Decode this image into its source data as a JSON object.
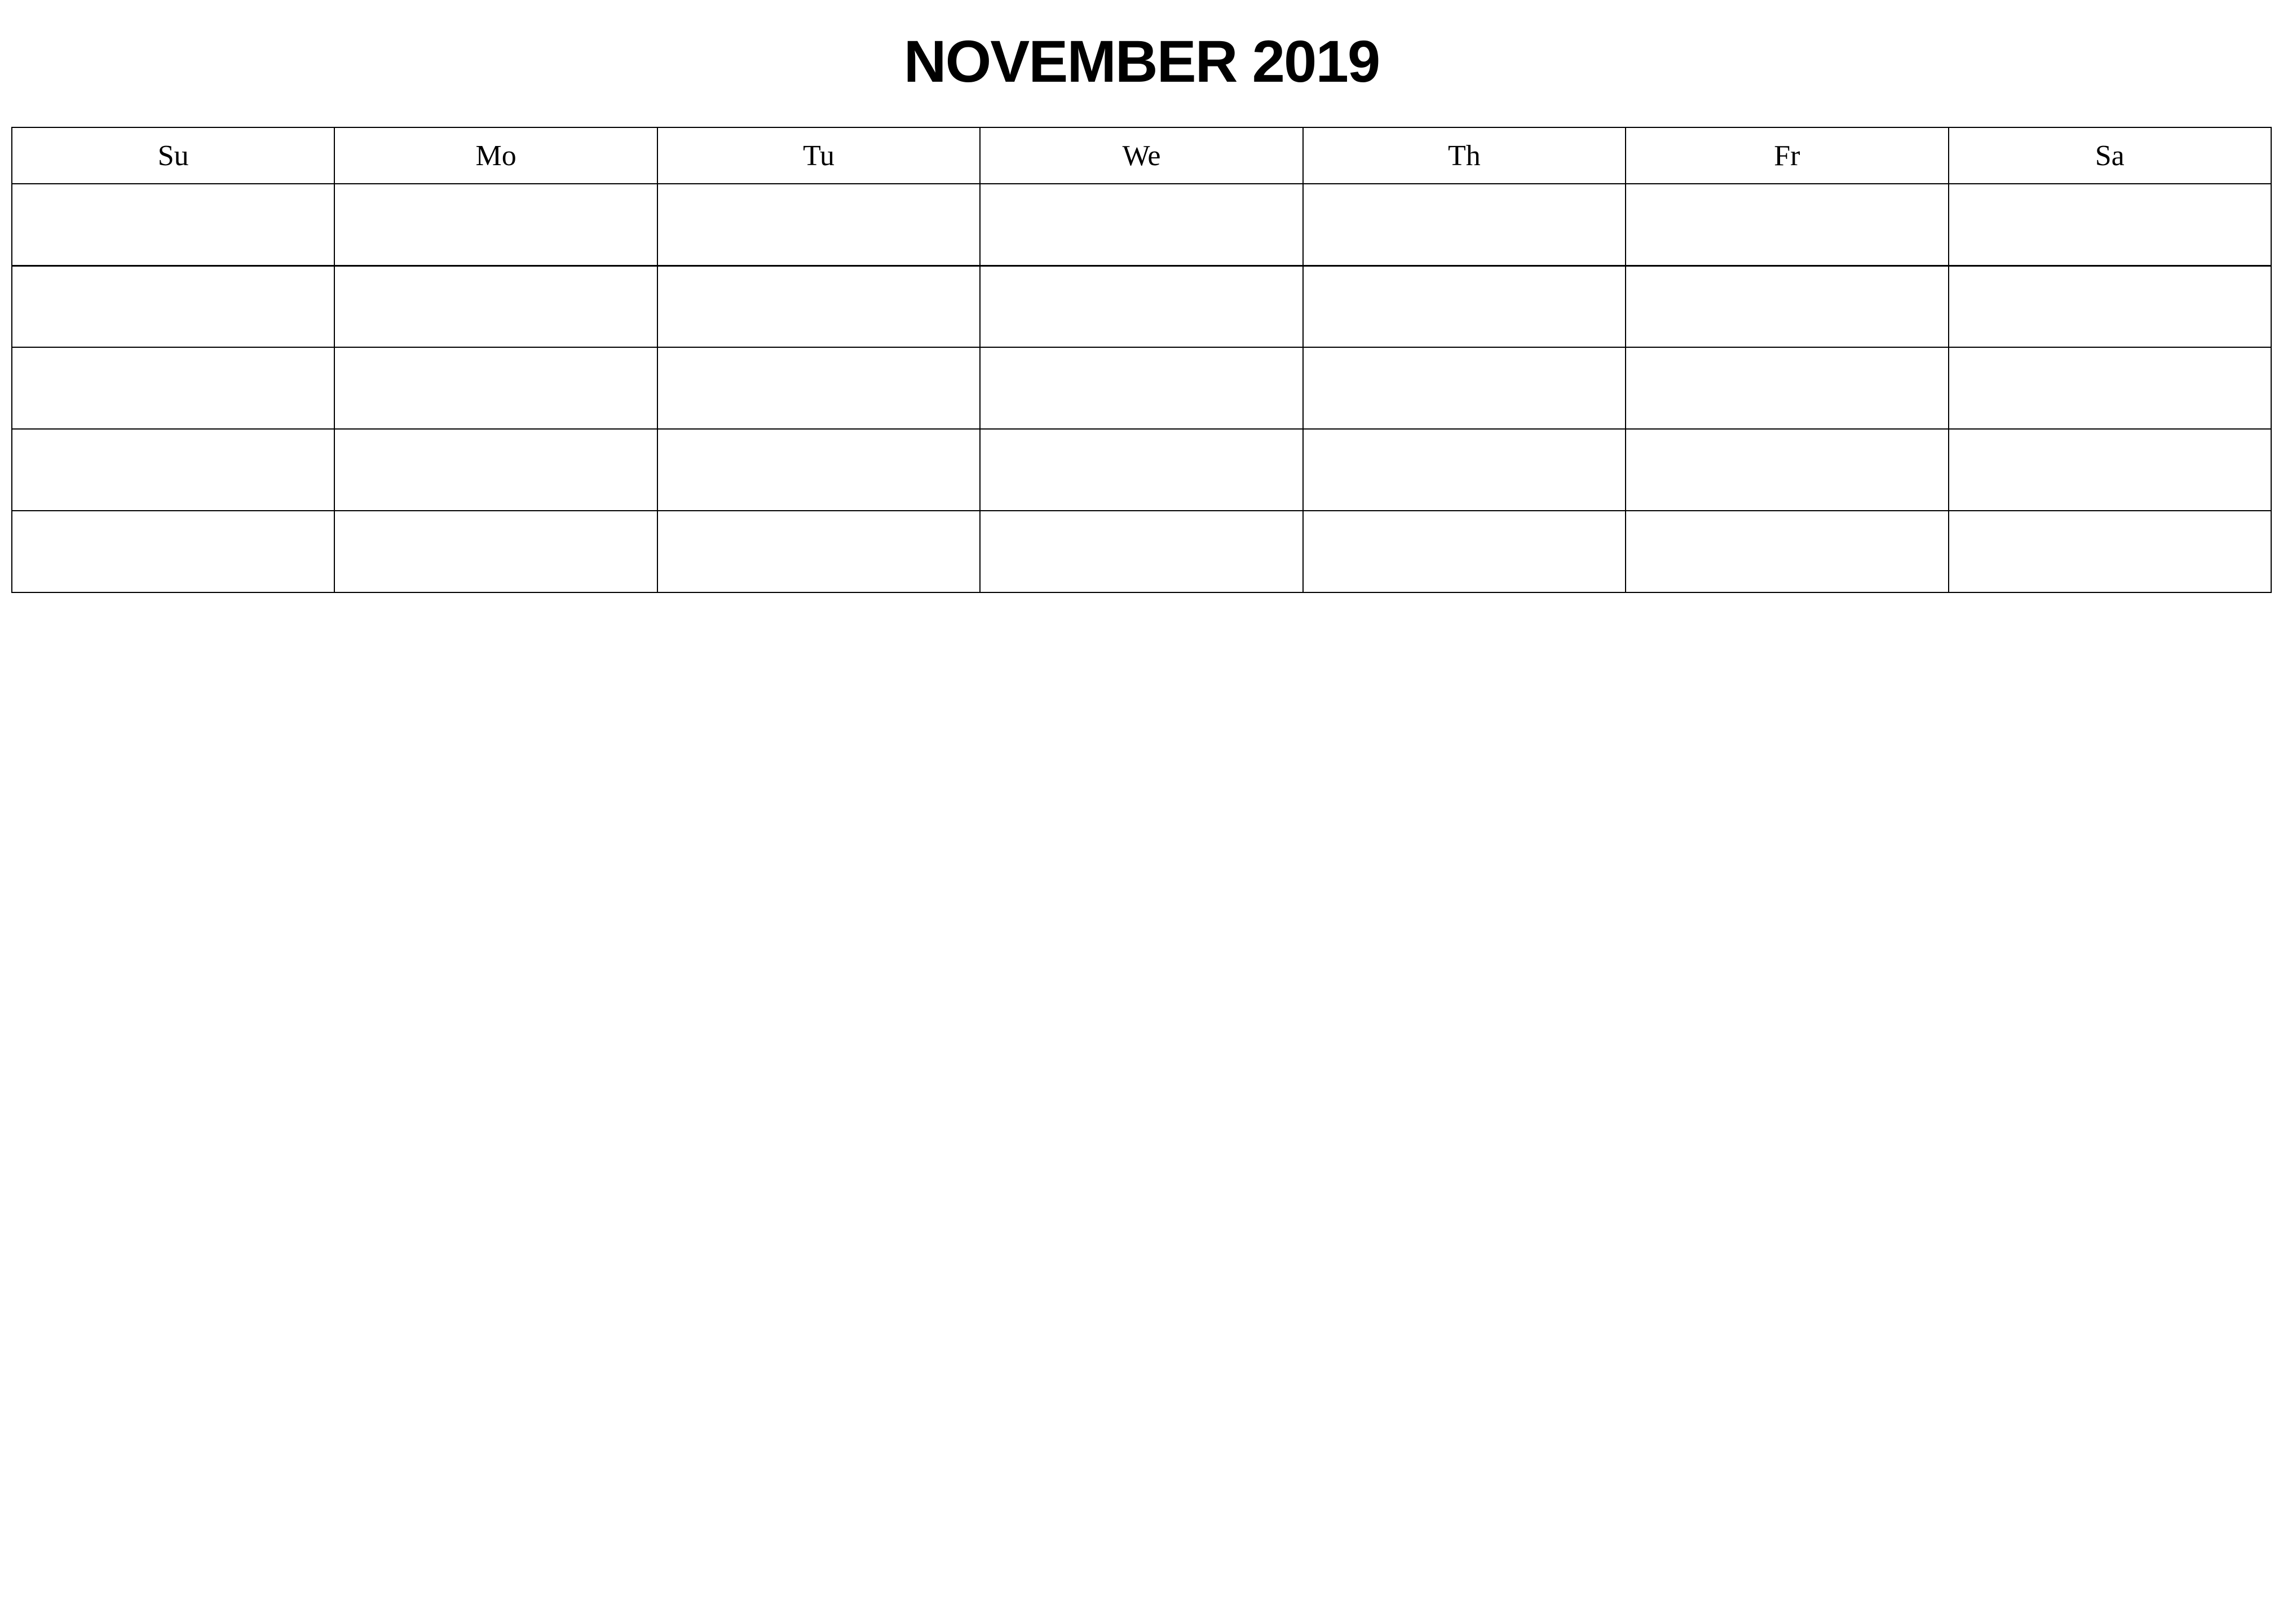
{
  "title": "NOVEMBER 2019",
  "day_headers": [
    "Su",
    "Mo",
    "Tu",
    "We",
    "Th",
    "Fr",
    "Sa"
  ],
  "weeks": [
    [
      "",
      "",
      "",
      "",
      "",
      "",
      ""
    ],
    [
      "",
      "",
      "",
      "",
      "",
      "",
      ""
    ],
    [
      "",
      "",
      "",
      "",
      "",
      "",
      ""
    ],
    [
      "",
      "",
      "",
      "",
      "",
      "",
      ""
    ],
    [
      "",
      "",
      "",
      "",
      "",
      "",
      ""
    ]
  ]
}
